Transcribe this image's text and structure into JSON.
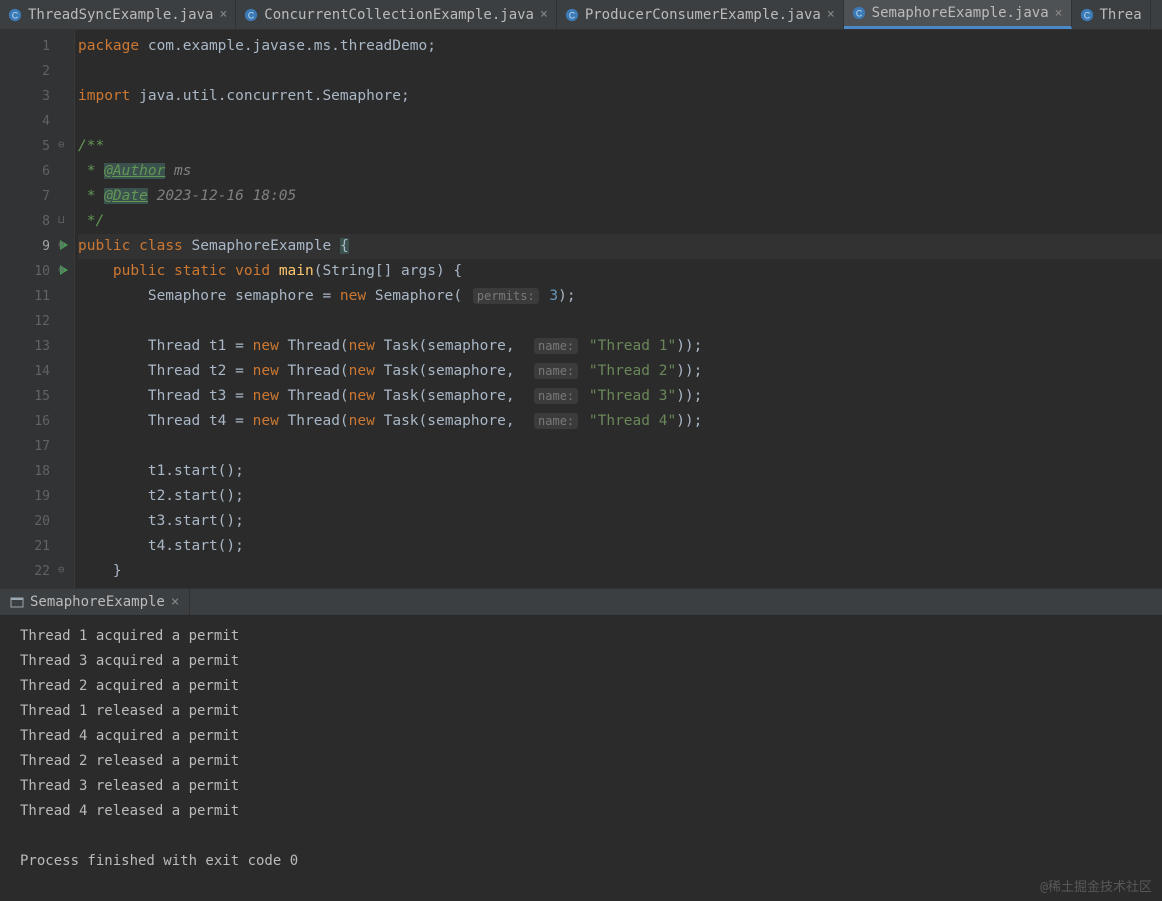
{
  "tabs": [
    {
      "label": "ThreadSyncExample.java",
      "active": false
    },
    {
      "label": "ConcurrentCollectionExample.java",
      "active": false
    },
    {
      "label": "ProducerConsumerExample.java",
      "active": false
    },
    {
      "label": "SemaphoreExample.java",
      "active": true
    },
    {
      "label": "Threa",
      "active": false,
      "truncated": true
    }
  ],
  "code": {
    "package": "package",
    "package_path": "com.example.javase.ms.threadDemo",
    "import": "import",
    "import_path": "java.util.concurrent.Semaphore",
    "doc_open": "/**",
    "doc_author_tag": "@Author",
    "doc_author_val": " ms",
    "doc_date_tag": "@Date",
    "doc_date_val": " 2023-12-16 18:05",
    "doc_close": " */",
    "public": "public",
    "class": "class",
    "class_name": "SemaphoreExample",
    "static": "static",
    "void": "void",
    "main": "main",
    "main_args": "(String[] args) {",
    "sem_decl_1": "Semaphore semaphore = ",
    "new": "new",
    "sem_decl_2": " Semaphore( ",
    "permits_hint": "permits:",
    "permits_val": "3",
    "sem_decl_3": ");",
    "thread_lines": [
      {
        "var": "t1",
        "name": "\"Thread 1\""
      },
      {
        "var": "t2",
        "name": "\"Thread 2\""
      },
      {
        "var": "t3",
        "name": "\"Thread 3\""
      },
      {
        "var": "t4",
        "name": "\"Thread 4\""
      }
    ],
    "thread_pre": "Thread ",
    "thread_eq": " = ",
    "thread_new1": " Thread(",
    "thread_new2": " Task(semaphore,  ",
    "name_hint": "name:",
    "thread_tail": "));",
    "start_lines": [
      "t1.start();",
      "t2.start();",
      "t3.start();",
      "t4.start();"
    ],
    "close_brace": "}"
  },
  "line_numbers": [
    "1",
    "2",
    "3",
    "4",
    "5",
    "6",
    "7",
    "8",
    "9",
    "10",
    "11",
    "12",
    "13",
    "14",
    "15",
    "16",
    "17",
    "18",
    "19",
    "20",
    "21",
    "22"
  ],
  "panel": {
    "run_title": "SemaphoreExample"
  },
  "console_output": [
    "Thread 1 acquired a permit",
    "Thread 3 acquired a permit",
    "Thread 2 acquired a permit",
    "Thread 1 released a permit",
    "Thread 4 acquired a permit",
    "Thread 2 released a permit",
    "Thread 3 released a permit",
    "Thread 4 released a permit",
    "",
    "Process finished with exit code 0"
  ],
  "watermark": "@稀土掘金技术社区"
}
